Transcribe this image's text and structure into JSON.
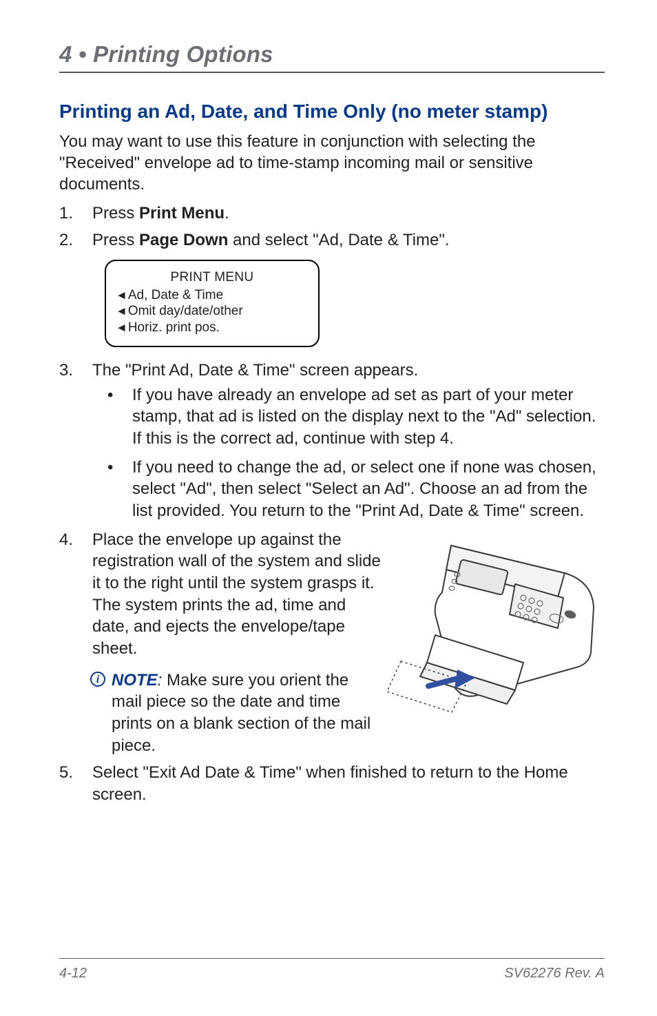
{
  "chapter": {
    "number": "4",
    "bullet": " • ",
    "title": "Printing Options"
  },
  "section": {
    "title": "Printing an Ad, Date, and Time Only (no meter stamp)"
  },
  "intro": "You may want to use this feature in conjunction with selecting the \"Received\" envelope ad to time-stamp incoming mail or sensitive documents.",
  "steps": {
    "s1": {
      "pre": "Press ",
      "bold": "Print Menu",
      "post": "."
    },
    "s2": {
      "pre": "Press ",
      "bold": "Page Down",
      "post": " and select \"Ad, Date & Time\"."
    },
    "s3": {
      "text": "The \"Print Ad, Date & Time\" screen appears.",
      "bullets": [
        "If you have already an envelope ad set as part of your meter stamp, that ad is listed on the display next to the \"Ad\" selection. If this is the correct ad, continue with step 4.",
        "If you need to change the ad, or select one if none was chosen, select \"Ad\", then select \"Select an Ad\". Choose an ad from the list provided. You return to the \"Print Ad, Date & Time\" screen."
      ]
    },
    "s4": {
      "text": "Place the envelope up against the registration wall of the system and slide it to the right until the system grasps it. The system prints the ad, time and date, and ejects the envelope/tape sheet.",
      "note_label": "NOTE",
      "note_colon": ":",
      "note_text": " Make sure you orient the mail piece so the date and time prints on a blank section of the mail piece."
    },
    "s5": {
      "text": "Select \"Exit Ad Date & Time\" when finished to return to the Home screen."
    }
  },
  "screen": {
    "title": "PRINT MENU",
    "items": [
      "Ad, Date & Time",
      "Omit day/date/other",
      "Horiz. print pos."
    ]
  },
  "footer": {
    "page": "4-12",
    "rev": "SV62276 Rev. A"
  }
}
